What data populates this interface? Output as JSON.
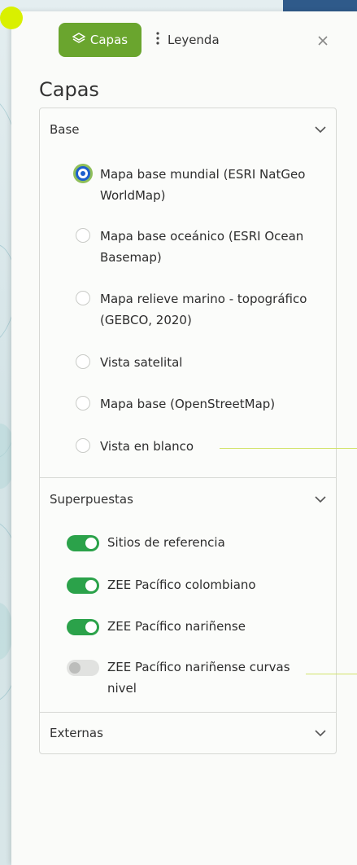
{
  "tabs": {
    "capas_label": "Capas",
    "leyenda_label": "Leyenda"
  },
  "panel": {
    "title": "Capas"
  },
  "sections": {
    "base": {
      "label": "Base",
      "options": [
        "Mapa base mundial (ESRI NatGeo WorldMap)",
        "Mapa base oceánico (ESRI Ocean Basemap)",
        "Mapa relieve marino - topográfico (GEBCO, 2020)",
        "Vista satelital",
        "Mapa base (OpenStreetMap)",
        "Vista en blanco"
      ],
      "selected": "Mapa base mundial (ESRI NatGeo WorldMap)"
    },
    "superpuestas": {
      "label": "Superpuestas",
      "layers": [
        {
          "label": "Sitios de referencia",
          "enabled": true
        },
        {
          "label": "ZEE Pacífico colombiano",
          "enabled": true
        },
        {
          "label": "ZEE Pacífico nariñense",
          "enabled": true
        },
        {
          "label": "ZEE Pacífico nariñense curvas nivel",
          "enabled": false
        }
      ]
    },
    "externas": {
      "label": "Externas"
    }
  },
  "colors": {
    "accent_green": "#6aa52e",
    "toggle_on": "#2ba24a",
    "radio_selected": "#1d5fcc"
  },
  "icons": {
    "capas_tab": "layers-icon",
    "leyenda_tab": "kebab-icon",
    "close": "close-icon",
    "section_toggle": "chevron-down-icon"
  }
}
